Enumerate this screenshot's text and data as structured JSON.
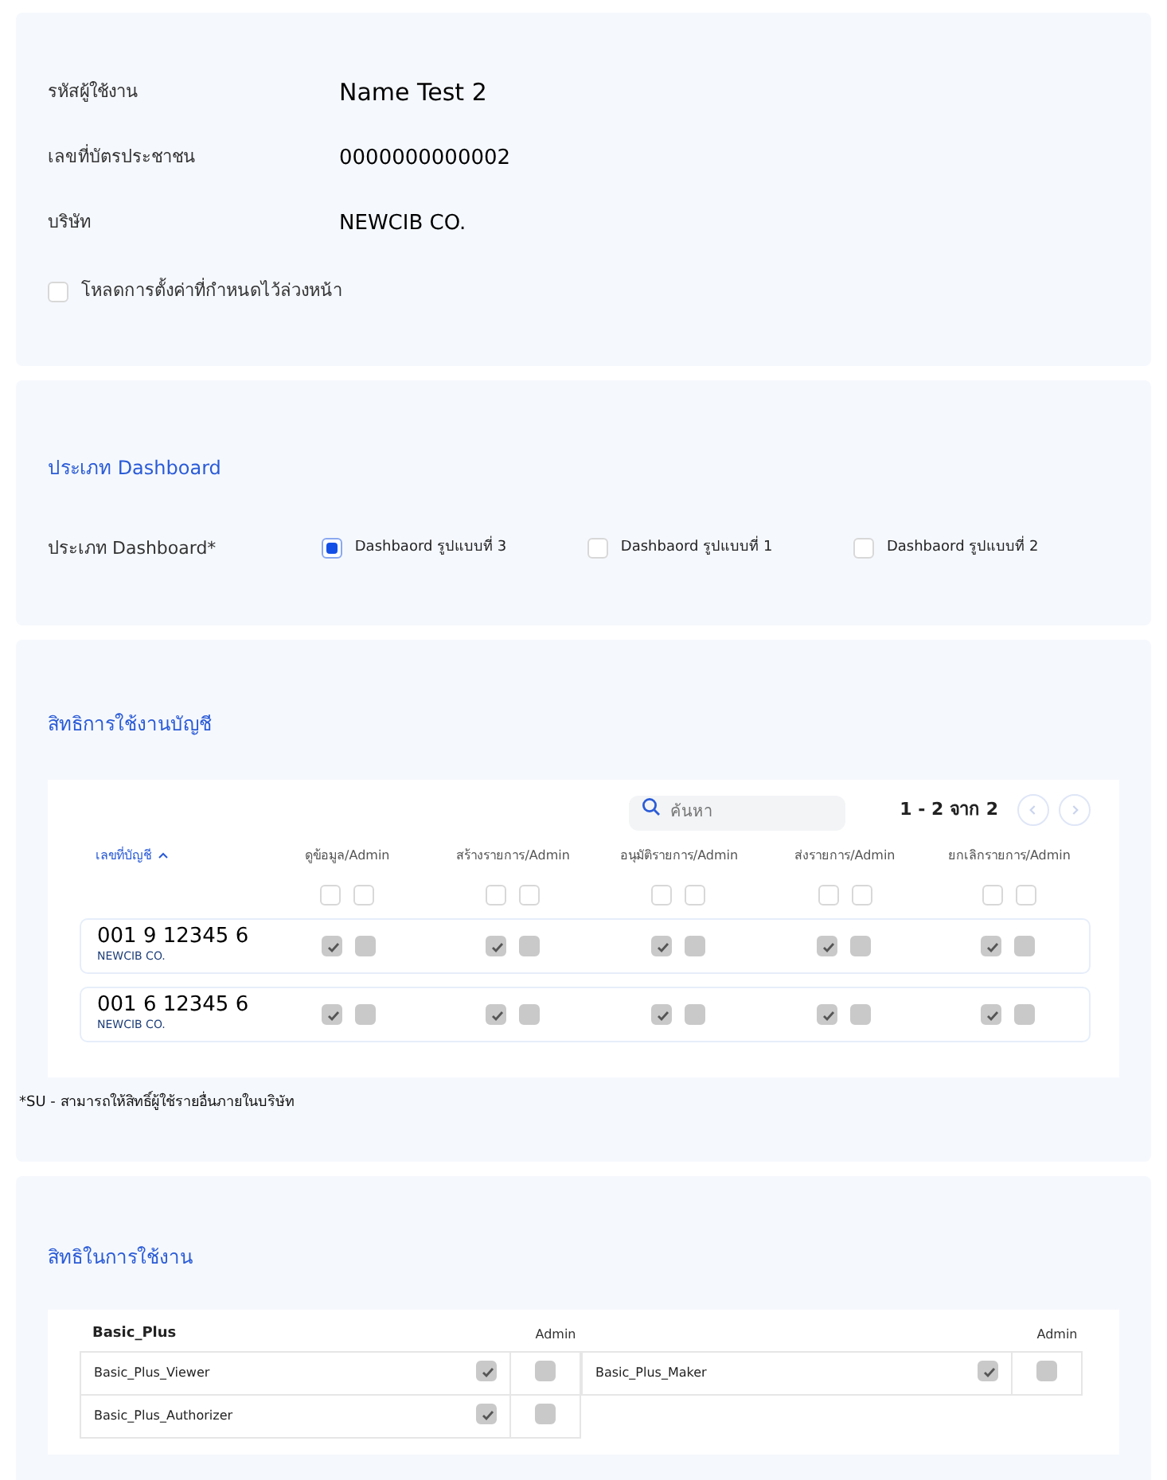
{
  "user_info": {
    "fields": [
      {
        "label": "รหัสผู้ใช้งาน",
        "value": "Name Test 2"
      },
      {
        "label": "เลขที่บัตรประชาชน",
        "value": "0000000000002"
      },
      {
        "label": "บริษัท",
        "value": "NEWCIB CO."
      }
    ],
    "preset": {
      "label": "โหลดการตั้งค่าที่กำหนดไว้ล่วงหน้า",
      "checked": false
    }
  },
  "dashboard": {
    "section_title": "ประเภท Dashboard",
    "label": "ประเภท Dashboard*",
    "options": [
      {
        "label": "Dashbaord รูปแบบที่ 3",
        "selected": true
      },
      {
        "label": "Dashbaord รูปแบบที่ 1",
        "selected": false
      },
      {
        "label": "Dashbaord รูปแบบที่ 2",
        "selected": false
      }
    ]
  },
  "accounts": {
    "section_title": "สิทธิการใช้งานบัญชี",
    "search": {
      "placeholder": "ค้นหา"
    },
    "pagination": "1 - 2 จาก 2",
    "account_column": "เลขที่บัญชี",
    "columns": [
      "ดูข้อมูล/Admin",
      "สร้างรายการ/Admin",
      "อนุมัติรายการ/Admin",
      "ส่งรายการ/Admin",
      "ยกเลิกรายการ/Admin"
    ],
    "header_checks": [
      [
        false,
        false
      ],
      [
        false,
        false
      ],
      [
        false,
        false
      ],
      [
        false,
        false
      ],
      [
        false,
        false
      ]
    ],
    "rows": [
      {
        "number": "001 9 12345 6",
        "company": "NEWCIB CO.",
        "checks": [
          [
            true,
            false
          ],
          [
            true,
            false
          ],
          [
            true,
            false
          ],
          [
            true,
            false
          ],
          [
            true,
            false
          ]
        ],
        "disabled": true
      },
      {
        "number": "001 6 12345 6",
        "company": "NEWCIB CO.",
        "checks": [
          [
            true,
            false
          ],
          [
            true,
            false
          ],
          [
            true,
            false
          ],
          [
            true,
            false
          ],
          [
            true,
            false
          ]
        ],
        "disabled": true
      }
    ],
    "footnote": "*SU - สามารถให้สิทธิ์ผู้ใช้รายอื่นภายในบริษัท"
  },
  "permissions": {
    "section_title": "สิทธิในการใช้งาน",
    "groups": [
      {
        "title": "Basic_Plus",
        "admin_label": "Admin",
        "items": [
          {
            "label": "Basic_Plus_Viewer",
            "checked": true,
            "admin": false,
            "disabled": true
          },
          {
            "label": "Basic_Plus_Authorizer",
            "checked": true,
            "admin": false,
            "disabled": true
          }
        ]
      },
      {
        "admin_label": "Admin",
        "items": [
          {
            "label": "Basic_Plus_Maker",
            "checked": true,
            "admin": false,
            "disabled": true
          }
        ]
      }
    ]
  }
}
